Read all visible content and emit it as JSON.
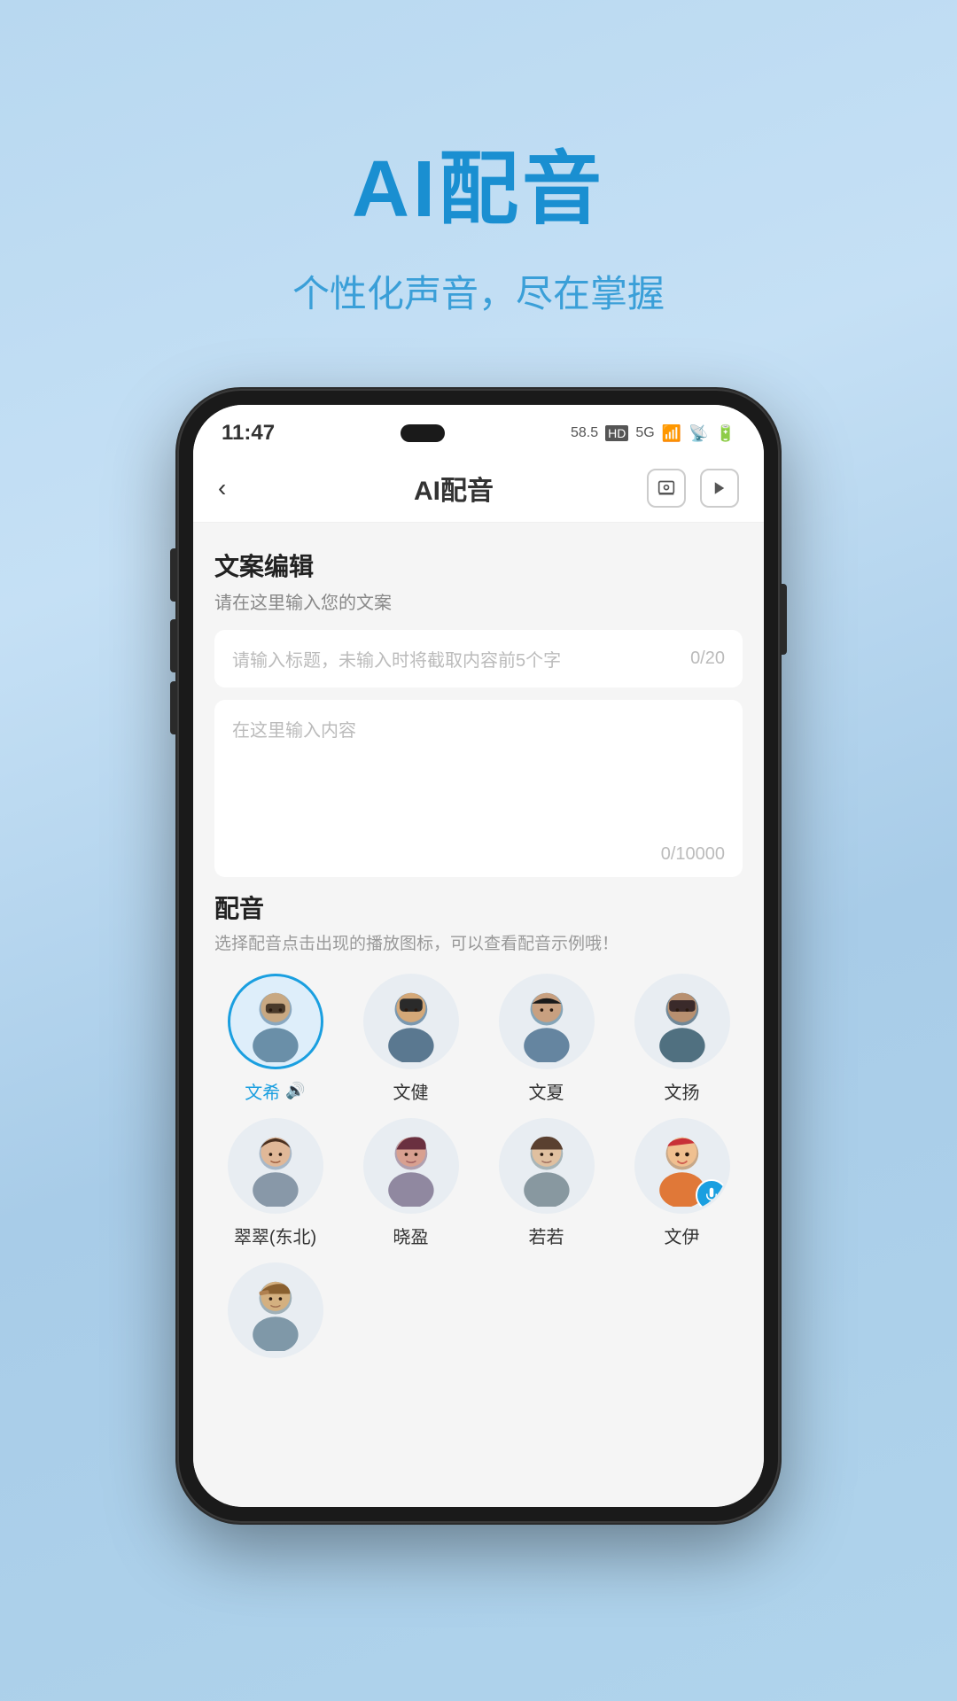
{
  "hero": {
    "title": "AI配音",
    "subtitle": "个性化声音，尽在掌握"
  },
  "phone": {
    "status_bar": {
      "time": "11:47",
      "icons": "58.5 HD 5G 信号 WiFi 4G"
    },
    "app_bar": {
      "title": "AI配音",
      "back_label": "‹",
      "search_icon": "search",
      "play_icon": "play"
    },
    "copywriting": {
      "section_title": "文案编辑",
      "section_subtitle": "请在这里输入您的文案",
      "title_placeholder": "请输入标题，未输入时将截取内容前5个字",
      "title_counter": "0/20",
      "content_placeholder": "在这里输入内容",
      "content_counter": "0/10000"
    },
    "dubbing": {
      "section_title": "配音",
      "section_hint": "选择配音点击出现的播放图标，可以查看配音示例哦！",
      "voices": [
        {
          "id": "wenxi",
          "name": "文希",
          "selected": true,
          "avatar_style": "avatar-1"
        },
        {
          "id": "wenjian",
          "name": "文健",
          "selected": false,
          "avatar_style": "avatar-2"
        },
        {
          "id": "wenxia",
          "name": "文夏",
          "selected": false,
          "avatar_style": "avatar-3"
        },
        {
          "id": "wenyang",
          "name": "文扬",
          "selected": false,
          "avatar_style": "avatar-4"
        },
        {
          "id": "cuicui",
          "name": "翠翠(东北)",
          "selected": false,
          "avatar_style": "avatar-5"
        },
        {
          "id": "xiaoying",
          "name": "晓盈",
          "selected": false,
          "avatar_style": "avatar-6"
        },
        {
          "id": "ruoruo",
          "name": "若若",
          "selected": false,
          "avatar_style": "avatar-7"
        },
        {
          "id": "wenyi",
          "name": "文伊",
          "selected": false,
          "avatar_style": "avatar-8",
          "has_overlay": true
        },
        {
          "id": "avatar9",
          "name": "",
          "selected": false,
          "avatar_style": "avatar-9"
        }
      ]
    }
  }
}
